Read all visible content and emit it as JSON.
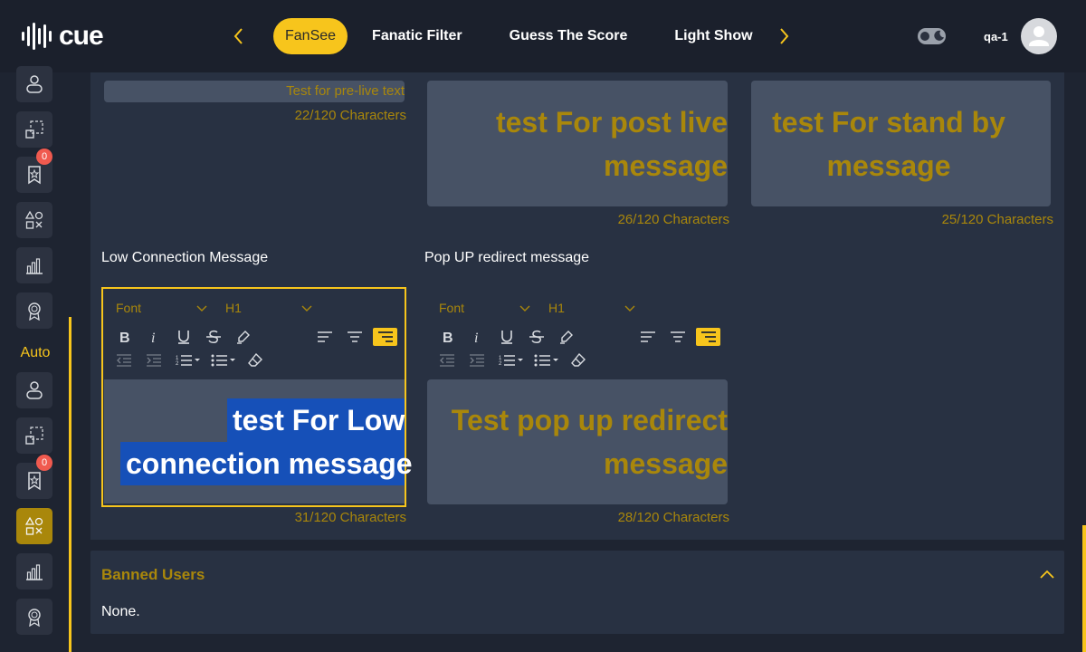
{
  "app": {
    "logo_text": "cue",
    "username": "qa-1"
  },
  "tabs": [
    {
      "label": "FanSee",
      "active": true
    },
    {
      "label": "Fanatic Filter",
      "active": false
    },
    {
      "label": "Guess The Score",
      "active": false
    },
    {
      "label": "Light Show",
      "active": false
    }
  ],
  "sidebar": {
    "section_auto": "Auto",
    "badge_count_1": "0",
    "badge_count_2": "0"
  },
  "messages": {
    "pre_live": {
      "text": "Test for pre-live text",
      "count": "22/120 Characters"
    },
    "post_live": {
      "text": "test For post live message",
      "count": "26/120 Characters"
    },
    "stand_by": {
      "text": "test For stand by message",
      "count": "25/120 Characters"
    },
    "low_connection": {
      "label": "Low Connection Message",
      "font_select": "Font",
      "heading_select": "H1",
      "text_line1": "test For Low",
      "text_line2": "connection message",
      "count": "31/120 Characters"
    },
    "popup_redirect": {
      "label": "Pop UP redirect message",
      "font_select": "Font",
      "heading_select": "H1",
      "text": "Test pop up redirect message",
      "count": "28/120 Characters"
    }
  },
  "banned_users": {
    "title": "Banned Users",
    "value": "None."
  },
  "colors": {
    "accent": "#f7c51c",
    "muted_gold": "#a9870b",
    "background": "#1e2431",
    "panel": "#283142",
    "input": "#475265",
    "selection": "#1650b8"
  }
}
